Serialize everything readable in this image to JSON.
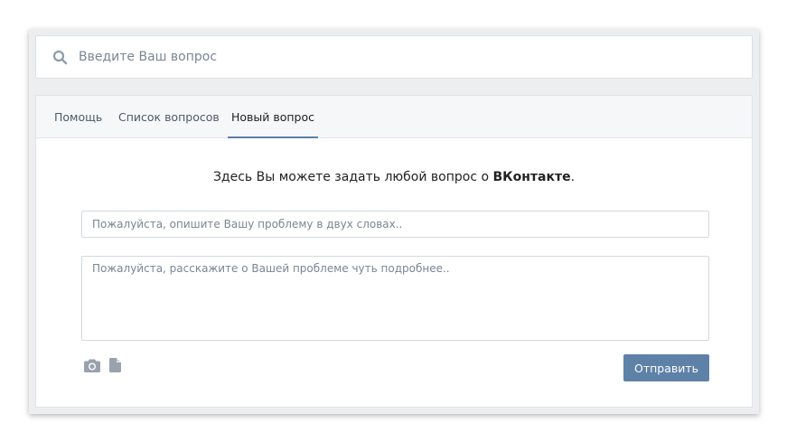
{
  "search": {
    "placeholder": "Введите Ваш вопрос",
    "value": ""
  },
  "tabs": [
    {
      "label": "Помощь",
      "active": false
    },
    {
      "label": "Список вопросов",
      "active": false
    },
    {
      "label": "Новый вопрос",
      "active": true
    }
  ],
  "intro": {
    "before": "Здесь Вы можете задать любой вопрос о ",
    "brand": "ВКонтакте",
    "after": "."
  },
  "form": {
    "subject_placeholder": "Пожалуйста, опишите Вашу проблему в двух словах..",
    "subject_value": "",
    "details_placeholder": "Пожалуйста, расскажите о Вашей проблеме чуть подробнее..",
    "details_value": "",
    "send_label": "Отправить"
  },
  "icons": {
    "search": "search-icon",
    "photo": "camera-icon",
    "document": "document-icon"
  },
  "colors": {
    "accent": "#5e81a8",
    "tab_underline": "#5c7fa6",
    "icon": "#99a2ad",
    "placeholder": "#7b8694"
  }
}
